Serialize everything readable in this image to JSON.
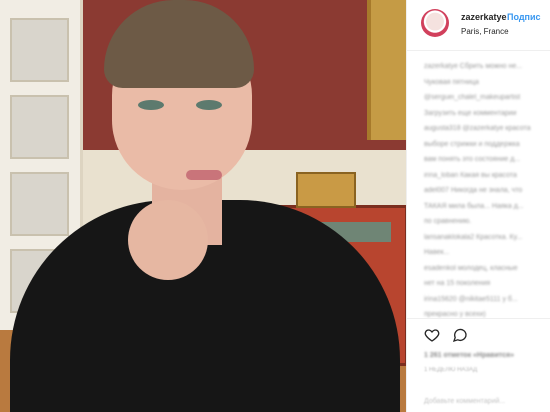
{
  "post": {
    "username": "zazerkatye",
    "follow_label": "Подпис",
    "location": "Paris, France",
    "photo_alt": "photo"
  },
  "comments": [
    {
      "text": "zazerkatye Сбрить можно не..."
    },
    {
      "text": "Чуковая пятница"
    },
    {
      "text": "@serguei_chalel_makeupartist"
    },
    {
      "text": "Загрузить еще комментарии"
    },
    {
      "text": "augusta318 @zazerkatye красота"
    },
    {
      "text": "выборе стрижки и поддержка"
    },
    {
      "text": "вам понять это состояние д..."
    },
    {
      "text": "irina_loban Какая вы красота"
    },
    {
      "text": "adel007 Никогда не знала, что"
    },
    {
      "text": "ТАКАЯ мила была... Наяка д..."
    },
    {
      "text": "по сравнению."
    },
    {
      "text": "larisanaklokala2 Красотка. Ку..."
    },
    {
      "text": "Навек..."
    },
    {
      "text": "esadenkol молодец, класные"
    },
    {
      "text": "нет на 15 поколения"
    },
    {
      "text": "irina15620 @nikitae5111 у б..."
    },
    {
      "text": "прекрасно у всехи)"
    }
  ],
  "actions": {
    "likes": "1 261 отметок «Нравится»",
    "time_ago": "1 НЕДЕЛЮ НАЗАД",
    "add_comment_placeholder": "Добавьте комментарий..."
  },
  "colors": {
    "link": "#3897f0",
    "text": "#262626",
    "muted": "#9a9a9a"
  }
}
